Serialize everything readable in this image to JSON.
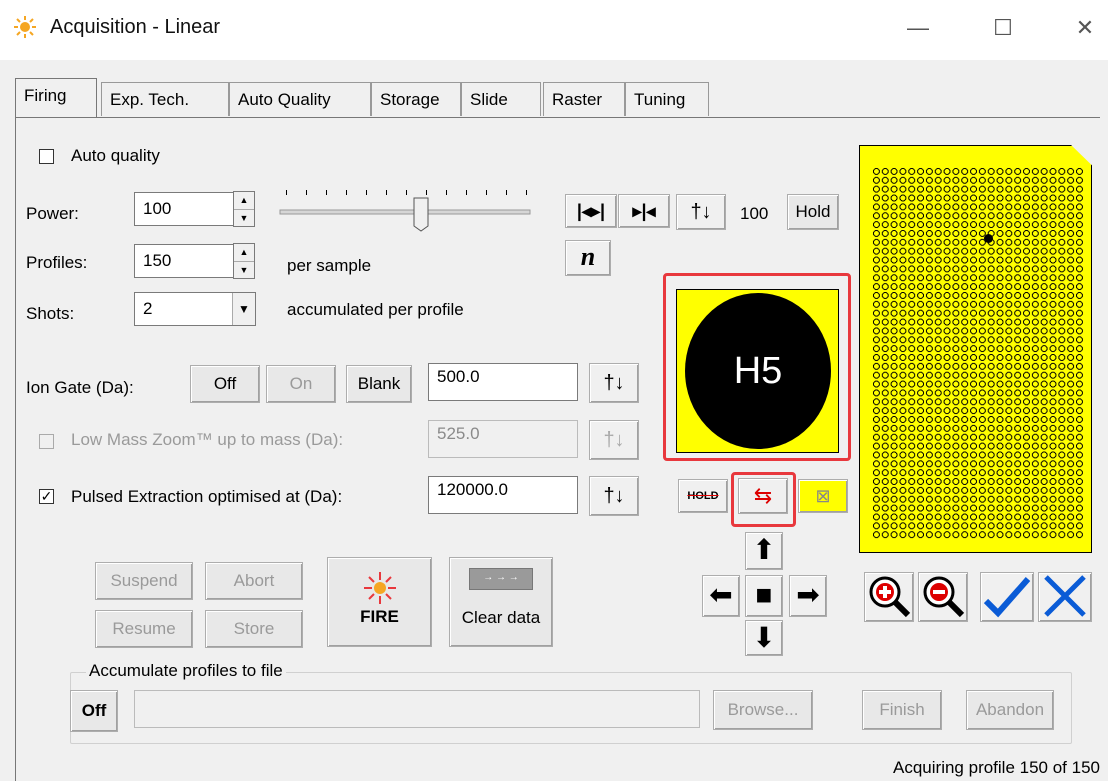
{
  "window": {
    "title": "Acquisition - Linear",
    "minimize": "—",
    "maximize": "☐",
    "close": "✕"
  },
  "tabs": [
    "Firing",
    "Exp. Tech.",
    "Auto Quality",
    "Storage",
    "Slide",
    "Raster",
    "Tuning"
  ],
  "auto_quality": {
    "label": "Auto quality",
    "checked": false
  },
  "power": {
    "label": "Power:",
    "value": "100"
  },
  "profiles": {
    "label": "Profiles:",
    "value": "150",
    "suffix": "per sample"
  },
  "shots": {
    "label": "Shots:",
    "value": "2",
    "suffix": "accumulated per profile"
  },
  "power_slider": {
    "fraction": 0.58
  },
  "laser_controls": {
    "value": "100",
    "hold_label": "Hold",
    "n_label": "n"
  },
  "ion_gate": {
    "label": "Ion Gate (Da):",
    "off": "Off",
    "on": "On",
    "blank": "Blank",
    "value": "500.0"
  },
  "low_mass_zoom": {
    "label": "Low Mass Zoom™ up to mass (Da):",
    "value": "525.0",
    "checked": false,
    "enabled": false
  },
  "pulsed_extraction": {
    "label": "Pulsed Extraction optimised at (Da):",
    "value": "120000.0",
    "checked": true
  },
  "spot": {
    "label": "H5"
  },
  "actions": {
    "suspend": "Suspend",
    "abort": "Abort",
    "resume": "Resume",
    "store": "Store",
    "fire": "FIRE",
    "clear": "Clear data"
  },
  "accumulate": {
    "group_label": "Accumulate profiles to file",
    "off": "Off",
    "path": "",
    "browse": "Browse...",
    "finish": "Finish",
    "abandon": "Abandon"
  },
  "status": "Acquiring profile 150 of 150",
  "colors": {
    "plate": "#ffff00",
    "highlight": "#e8383d",
    "accent_blue": "#0a5bd6"
  }
}
